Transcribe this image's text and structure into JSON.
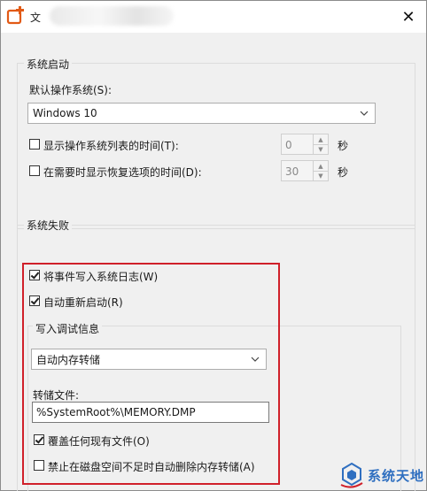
{
  "window": {
    "title_fragment": "文",
    "close_glyph": "✕"
  },
  "startup": {
    "title": "系统启动",
    "default_os_label": "默认操作系统(S):",
    "default_os_value": "Windows 10",
    "show_os_list": {
      "label": "显示操作系统列表的时间(T):",
      "checked": false,
      "value": "0",
      "unit": "秒"
    },
    "show_recovery": {
      "label": "在需要时显示恢复选项的时间(D):",
      "checked": false,
      "value": "30",
      "unit": "秒"
    }
  },
  "failure": {
    "title": "系统失败",
    "write_event": {
      "label": "将事件写入系统日志(W)",
      "checked": true
    },
    "auto_restart": {
      "label": "自动重新启动(R)",
      "checked": true
    },
    "debug_info": {
      "title": "写入调试信息",
      "type_value": "自动内存转储",
      "dump_file_label": "转储文件:",
      "dump_file_value": "%SystemRoot%\\MEMORY.DMP",
      "overwrite": {
        "label": "覆盖任何现有文件(O)",
        "checked": true
      },
      "disable_auto_delete": {
        "label": "禁止在磁盘空间不足时自动删除内存转储(A)",
        "checked": false
      }
    }
  },
  "watermark": {
    "text": "系统天地"
  },
  "colors": {
    "highlight": "#d0202a",
    "watermark": "#2f6fc0"
  }
}
